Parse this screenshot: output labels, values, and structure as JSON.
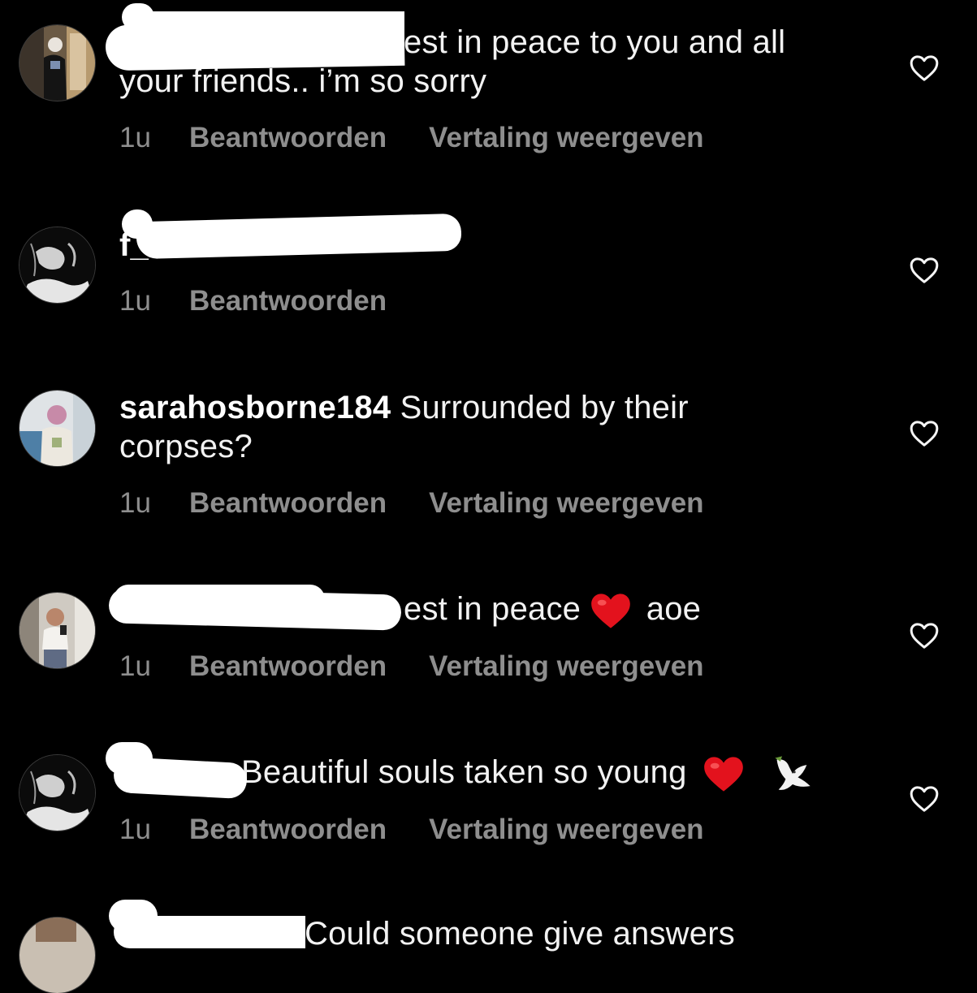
{
  "comments": [
    {
      "text_line1": "est in peace to you and all",
      "text_line2": "your friends.. i’m so sorry",
      "time": "1u",
      "reply": "Beantwoorden",
      "translate": "Vertaling weergeven",
      "avatar_icon": "user-photo-avatar"
    },
    {
      "username_partial": "f_",
      "time": "1u",
      "reply": "Beantwoorden",
      "avatar_icon": "black-white-avatar"
    },
    {
      "username": "sarahosborne184",
      "text": " Surrounded by their corpses?",
      "time": "1u",
      "reply": "Beantwoorden",
      "translate": "Vertaling weergeven",
      "avatar_icon": "user-photo-avatar"
    },
    {
      "text_a": "est in peace ",
      "text_b": " aoe",
      "emoji": "red-heart-icon",
      "time": "1u",
      "reply": "Beantwoorden",
      "translate": "Vertaling weergeven",
      "avatar_icon": "user-photo-avatar"
    },
    {
      "text": "Beautiful souls taken so young ",
      "emojis": [
        "red-heart-icon",
        "dove-icon"
      ],
      "time": "1u",
      "reply": "Beantwoorden",
      "translate": "Vertaling weergeven",
      "avatar_icon": "black-white-avatar"
    },
    {
      "text": "Could someone give answers",
      "avatar_icon": "user-photo-avatar"
    }
  ],
  "colors": {
    "background": "#000000",
    "text": "#f2f2f2",
    "meta": "#8e8e8e",
    "heart_emoji": "#e3121d",
    "redaction": "#ffffff"
  }
}
